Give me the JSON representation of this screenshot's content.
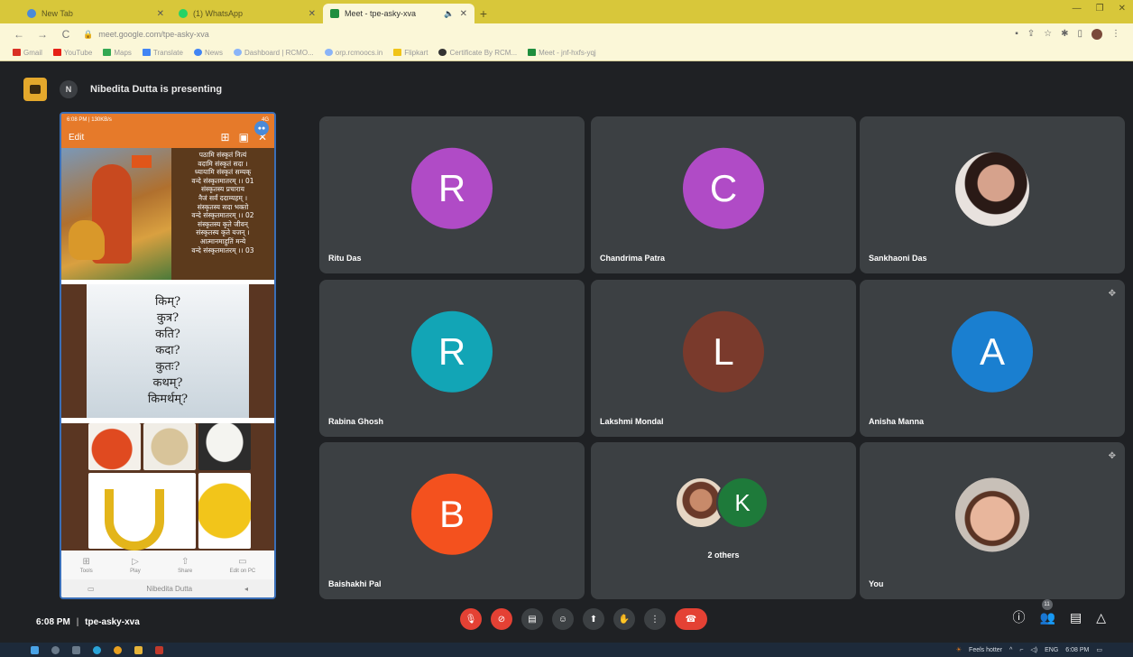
{
  "browser": {
    "tabs": [
      {
        "title": "New Tab",
        "icon_color": "#4a8ad8"
      },
      {
        "title": "(1) WhatsApp",
        "icon_color": "#25d366"
      },
      {
        "title": "Meet - tpe-asky-xva",
        "icon_color": "#1e8e3e"
      }
    ],
    "url": "meet.google.com/tpe-asky-xva",
    "bookmarks": [
      {
        "label": "Gmail",
        "color": "#d93025"
      },
      {
        "label": "YouTube",
        "color": "#e62117"
      },
      {
        "label": "Maps",
        "color": "#34a853"
      },
      {
        "label": "Translate",
        "color": "#4285f4"
      },
      {
        "label": "News",
        "color": "#4285f4"
      },
      {
        "label": "Dashboard | RCMO...",
        "color": "#8ab4f8"
      },
      {
        "label": "orp.rcmoocs.in",
        "color": "#8ab4f8"
      },
      {
        "label": "Flipkart",
        "color": "#f0c419"
      },
      {
        "label": "Certificate By RCM...",
        "color": "#333333"
      },
      {
        "label": "Meet - jnf-hxfs-yqj",
        "color": "#1e8e3e"
      }
    ]
  },
  "meet": {
    "presenter_initial": "N",
    "presenting_text": "Nibedita Dutta is presenting",
    "meeting_time": "6:08 PM",
    "meeting_code": "tpe-asky-xva",
    "meeting_separator": "|"
  },
  "phone": {
    "status_left": "6:08 PM | 130KB/s",
    "status_right": "4G",
    "toolbar_title": "Edit",
    "verse_lines": [
      "पठामि संस्कृतं नित्यं",
      "वदामि संस्कृतं सदा ।",
      "ध्यायामि संस्कृतं सम्यक्",
      "वन्दे संस्कृतमातरम् ।। 01",
      "संस्कृतस्य प्रचाराय",
      "नैजं सर्वं ददाम्यहम् ।",
      "संस्कृतस्य सदा भक्तो",
      "वन्दे संस्कृतमातरम् ।। 02",
      "संस्कृतस्य कृते जीवन्",
      "संस्कृतस्य कृते यजन् ।",
      "आत्मानमाहुतिं मन्ये",
      "वन्दे संस्कृतमातरम् ।। 03"
    ],
    "question_words": [
      "किम्?",
      "कुत्र?",
      "कति?",
      "कदा?",
      "कुतः?",
      "कथम्?",
      "किमर्थम्?"
    ],
    "bottom_actions": [
      {
        "label": "Tools",
        "icon": "grid-icon"
      },
      {
        "label": "Play",
        "icon": "play-icon"
      },
      {
        "label": "Share",
        "icon": "share-icon"
      },
      {
        "label": "Edit on PC",
        "icon": "pc-icon"
      }
    ],
    "nav_label": "Nibedita Dutta"
  },
  "participants": [
    {
      "name": "Ritu Das",
      "initial": "R",
      "color": "#b04bc6"
    },
    {
      "name": "Chandrima Patra",
      "initial": "C",
      "color": "#b04bc6"
    },
    {
      "name": "Sankhaoni Das",
      "initial": "",
      "color": ""
    },
    {
      "name": "Rabina Ghosh",
      "initial": "R",
      "color": "#12a5b6"
    },
    {
      "name": "Lakshmi Mondal",
      "initial": "L",
      "color": "#7a3a2c"
    },
    {
      "name": "Anisha Manna",
      "initial": "A",
      "color": "#1a7fd0"
    },
    {
      "name": "Baishakhi Pal",
      "initial": "B",
      "color": "#f4511e"
    },
    {
      "name": "2 others",
      "initial": "K",
      "color": "#1e7a3a"
    },
    {
      "name": "You",
      "initial": "",
      "color": ""
    }
  ],
  "controls": {
    "people_count": "11"
  },
  "taskbar": {
    "weather": "Feels hotter",
    "language": "ENG",
    "time": "6:08 PM"
  }
}
